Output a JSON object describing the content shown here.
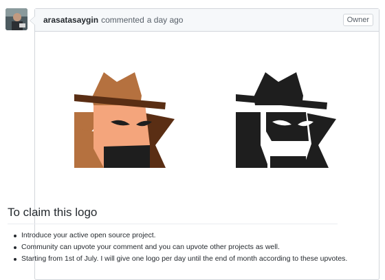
{
  "comment": {
    "author": "arasatasaygin",
    "action": "commented",
    "timestamp": "a day ago",
    "role_badge": "Owner"
  },
  "logos": {
    "color_version": {
      "colors": {
        "hat": "#b5713f",
        "hat_band": "#5a2e14",
        "face": "#f4a57c",
        "cape_left": "#b5713f",
        "cape_right": "#5a2e14",
        "mask": "#1e1e1e"
      }
    },
    "mono_version": {
      "colors": {
        "body": "#1e1e1e",
        "face": "#ffffff"
      }
    }
  },
  "content": {
    "heading": "To claim this logo",
    "bullets": [
      "Introduce your active open source project.",
      "Community can upvote your comment and you can upvote other projects as well.",
      "Starting from 1st of July. I will give one logo per day until the end of month according to these upvotes."
    ]
  }
}
